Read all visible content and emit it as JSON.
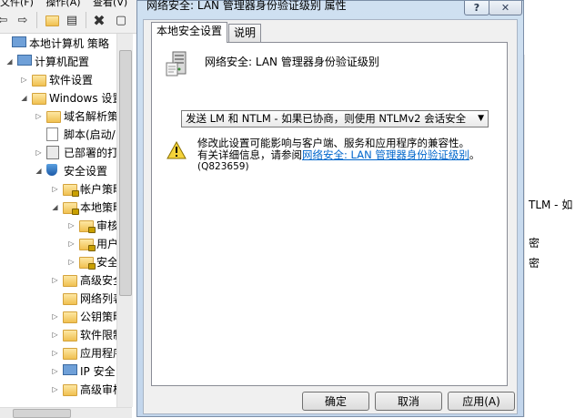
{
  "mmc": {
    "menu": [
      "文件(F)",
      "操作(A)",
      "查看(V)"
    ],
    "tree": [
      {
        "label": "本地计算机 策略",
        "level": 0,
        "expander": "",
        "icon": "computer"
      },
      {
        "label": "计算机配置",
        "level": 1,
        "expander": "◢",
        "icon": "computer"
      },
      {
        "label": "软件设置",
        "level": 2,
        "expander": "▷",
        "icon": "folder"
      },
      {
        "label": "Windows 设置",
        "level": 2,
        "expander": "◢",
        "icon": "folder"
      },
      {
        "label": "域名解析策",
        "level": 3,
        "expander": "▷",
        "icon": "folder"
      },
      {
        "label": "脚本(启动/",
        "level": 3,
        "expander": "",
        "icon": "doc"
      },
      {
        "label": "已部署的打",
        "level": 3,
        "expander": "▷",
        "icon": "sheet"
      },
      {
        "label": "安全设置",
        "level": 3,
        "expander": "◢",
        "icon": "shield"
      },
      {
        "label": "帐户策略",
        "level": 4,
        "expander": "▷",
        "icon": "lockfolder"
      },
      {
        "label": "本地策略",
        "level": 4,
        "expander": "◢",
        "icon": "lockfolder"
      },
      {
        "label": "审核",
        "level": 5,
        "expander": "▷",
        "icon": "lockfolder"
      },
      {
        "label": "用户",
        "level": 5,
        "expander": "▷",
        "icon": "lockfolder"
      },
      {
        "label": "安全",
        "level": 5,
        "expander": "▷",
        "icon": "lockfolder"
      },
      {
        "label": "高级安全",
        "level": 4,
        "expander": "▷",
        "icon": "folder"
      },
      {
        "label": "网络列表",
        "level": 4,
        "expander": "",
        "icon": "folder"
      },
      {
        "label": "公钥策略",
        "level": 4,
        "expander": "▷",
        "icon": "folder"
      },
      {
        "label": "软件限制",
        "level": 4,
        "expander": "▷",
        "icon": "folder"
      },
      {
        "label": "应用程序",
        "level": 4,
        "expander": "▷",
        "icon": "folder"
      },
      {
        "label": "IP 安全",
        "level": 4,
        "expander": "▷",
        "icon": "computer"
      },
      {
        "label": "高级审核",
        "level": 4,
        "expander": "▷",
        "icon": "folder"
      }
    ],
    "right_pane": [
      "TLM - 如",
      "密",
      "密"
    ]
  },
  "dialog": {
    "title": "网络安全: LAN 管理器身份验证级别 属性",
    "help_label": "?",
    "close_label": "✕",
    "tabs": [
      "本地安全设置",
      "说明"
    ],
    "active_tab": 0,
    "policy_name": "网络安全: LAN 管理器身份验证级别",
    "selected_option": "发送 LM 和 NTLM - 如果已协商，则使用 NTLMv2 会话安全",
    "warning_line1": "修改此设置可能影响与客户端、服务和应用程序的兼容性。",
    "warning_line2_prefix": "有关详细信息，请参阅",
    "warning_link": "网络安全: LAN 管理器身份验证级别",
    "warning_line2_suffix": "。",
    "warning_kb": "(Q823659)",
    "buttons": {
      "ok": "确定",
      "cancel": "取消",
      "apply": "应用(A)"
    }
  }
}
